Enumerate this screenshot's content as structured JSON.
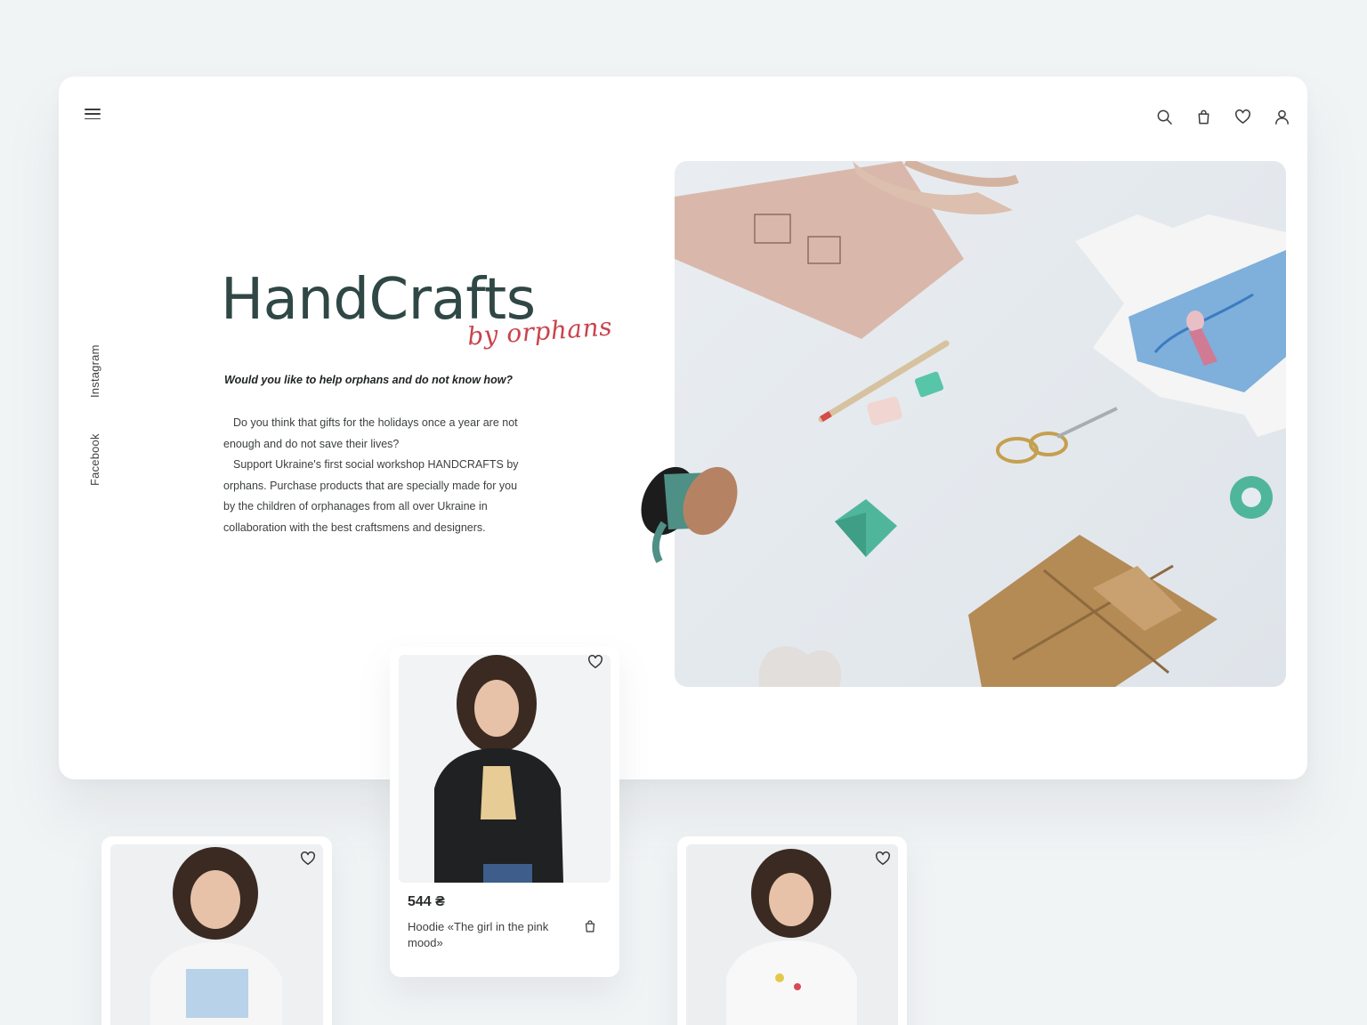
{
  "header": {
    "menu_icon": "hamburger-menu-icon",
    "icons": [
      "search-icon",
      "shopping-bag-icon",
      "heart-icon",
      "user-icon"
    ]
  },
  "social": {
    "instagram": "Instagram",
    "facebook": "Facebook"
  },
  "hero": {
    "title": "HandCrafts",
    "subtitle": "by orphans",
    "tagline": "Would you like to help orphans and do not know how?",
    "paragraph_1": "Do you think that gifts for the holidays once a year are not enough and do not save their lives?",
    "paragraph_2": "Support Ukraine's first social workshop HANDCRAFTS by orphans. Purchase products that are specially made for you by the children of orphanages from all over Ukraine in collaboration with the best craftsmens and designers."
  },
  "products": {
    "featured": {
      "price": "544 ₴",
      "name": "Hoodie «The girl in the pink mood»"
    }
  },
  "colors": {
    "background": "#f1f4f5",
    "brand_dark": "#2f4745",
    "brand_accent": "#c9434d",
    "mint": "#4fb69c"
  }
}
